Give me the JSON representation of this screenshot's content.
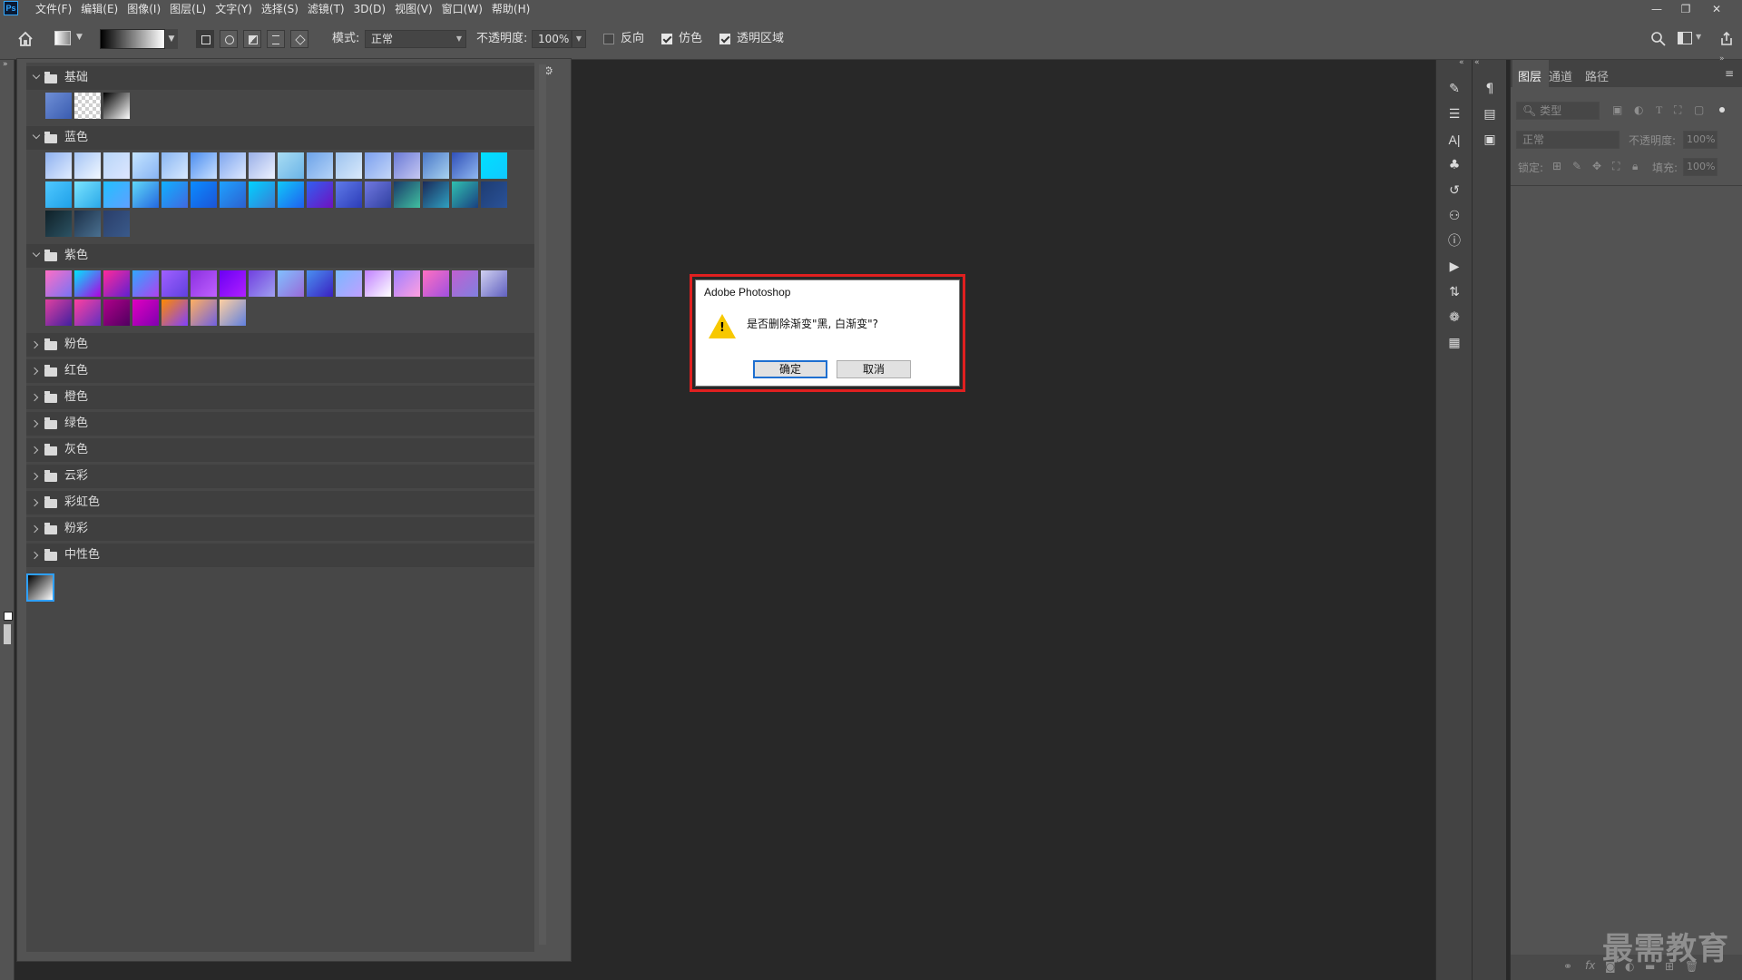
{
  "app": {
    "logo_text": "Ps"
  },
  "menu": [
    "文件(F)",
    "编辑(E)",
    "图像(I)",
    "图层(L)",
    "文字(Y)",
    "选择(S)",
    "滤镜(T)",
    "3D(D)",
    "视图(V)",
    "窗口(W)",
    "帮助(H)"
  ],
  "window_controls": {
    "minimize": "—",
    "restore": "❐",
    "close": "✕"
  },
  "options_bar": {
    "mode_label": "模式:",
    "mode_value": "正常",
    "opacity_label": "不透明度:",
    "opacity_value": "100%",
    "reverse_label": "反向",
    "reverse_checked": false,
    "dither_label": "仿色",
    "dither_checked": true,
    "transparency_label": "透明区域",
    "transparency_checked": true
  },
  "gradient_picker": {
    "groups_open": [
      {
        "name": "基础",
        "colors": [
          [
            "#6f8fd6",
            "#3a5cb0"
          ],
          [
            "#d0d0d0",
            "#ffffff"
          ],
          [
            "#000000",
            "#ffffff"
          ]
        ]
      },
      {
        "name": "蓝色",
        "colors": [
          [
            "#8fb2f0",
            "#e0ecff"
          ],
          [
            "#a4c4f5",
            "#f2f8ff"
          ],
          [
            "#b8d6f8",
            "#dde6ff"
          ],
          [
            "#c4e4ff",
            "#88b4f4"
          ],
          [
            "#8ab6f2",
            "#d8e9ff"
          ],
          [
            "#4d8ef0",
            "#c8e0ff"
          ],
          [
            "#7fa6ee",
            "#dde8ff"
          ],
          [
            "#9ab0e8",
            "#eef2ff"
          ],
          [
            "#a8dcf2",
            "#6bb4e8"
          ],
          [
            "#6da3e8",
            "#b5d3f8"
          ],
          [
            "#9dc3ef",
            "#d9e9fb"
          ],
          [
            "#7ca0ef",
            "#c4d6f8"
          ],
          [
            "#6a7ad6",
            "#c6c8f2"
          ],
          [
            "#4a78c8",
            "#a8d2f0"
          ],
          [
            "#3050b8",
            "#90b8f0"
          ],
          [
            "#00e0ff",
            "#10c8ff"
          ],
          [
            "#4fc8ff",
            "#1fa0e8"
          ],
          [
            "#7ae4ff",
            "#2aa8e8"
          ],
          [
            "#22c0ff",
            "#5fa0ff"
          ],
          [
            "#60d8f8",
            "#2468e0"
          ],
          [
            "#10b0ff",
            "#4068e0"
          ],
          [
            "#0a8cff",
            "#1c54d8"
          ],
          [
            "#1ea2ff",
            "#2c60d0"
          ],
          [
            "#00d2ff",
            "#3a7bd5"
          ],
          [
            "#10c8f8",
            "#2060f0"
          ],
          [
            "#3060f0",
            "#7010c0"
          ],
          [
            "#5f7ae8",
            "#2c3cb8"
          ],
          [
            "#7078e0",
            "#3040a0"
          ],
          [
            "#1a3a6a",
            "#40c0a0"
          ],
          [
            "#1a2a5a",
            "#30a0c0"
          ],
          [
            "#30c0b0",
            "#1a4080"
          ],
          [
            "#1e3c72",
            "#2a5298"
          ],
          [
            "#0f2027",
            "#2c5364"
          ],
          [
            "#1c3048",
            "#4a7090"
          ],
          [
            "#2a3e6a",
            "#3a5a8a"
          ]
        ]
      },
      {
        "name": "紫色",
        "colors": [
          [
            "#ff6ec4",
            "#7873f5"
          ],
          [
            "#00e5ff",
            "#b000e0"
          ],
          [
            "#ff2a9a",
            "#6020d0"
          ],
          [
            "#30a8ff",
            "#b040f0"
          ],
          [
            "#a060ff",
            "#6040e0"
          ],
          [
            "#8a30e0",
            "#c060ff"
          ],
          [
            "#6a00f4",
            "#b020ff"
          ],
          [
            "#7040e0",
            "#a0a0f0"
          ],
          [
            "#80c0ff",
            "#9a6ad8"
          ],
          [
            "#4a90f0",
            "#3a20c0"
          ],
          [
            "#7ab8ff",
            "#c0a0ff"
          ],
          [
            "#c080ff",
            "#ffffff"
          ],
          [
            "#a080ff",
            "#ffa0e0"
          ],
          [
            "#ff70c0",
            "#a050e0"
          ],
          [
            "#c060d0",
            "#8080e0"
          ],
          [
            "#d0d0f0",
            "#6060c0"
          ],
          [
            "#e040a0",
            "#4020a0"
          ],
          [
            "#ff40a0",
            "#6030c0"
          ],
          [
            "#b0008a",
            "#500060"
          ],
          [
            "#e000c0",
            "#8000b0"
          ],
          [
            "#ff8a00",
            "#8040ff"
          ],
          [
            "#ffb060",
            "#7060e0"
          ],
          [
            "#ffd0a0",
            "#6080e0"
          ]
        ]
      }
    ],
    "groups_closed": [
      "粉色",
      "红色",
      "橙色",
      "绿色",
      "灰色",
      "云彩",
      "彩虹色",
      "粉彩",
      "中性色"
    ]
  },
  "layers_panel": {
    "tabs": [
      "图层",
      "通道",
      "路径"
    ],
    "filter_placeholder": "类型",
    "blend_mode": "正常",
    "opacity_label": "不透明度:",
    "opacity_value": "100%",
    "lock_label": "锁定:",
    "fill_label": "填充:",
    "fill_value": "100%"
  },
  "dialog": {
    "title": "Adobe Photoshop",
    "message": "是否删除渐变\"黑, 白渐变\"?",
    "ok_label": "确定",
    "cancel_label": "取消",
    "warning_mark": "!"
  },
  "watermark": "最需教育"
}
